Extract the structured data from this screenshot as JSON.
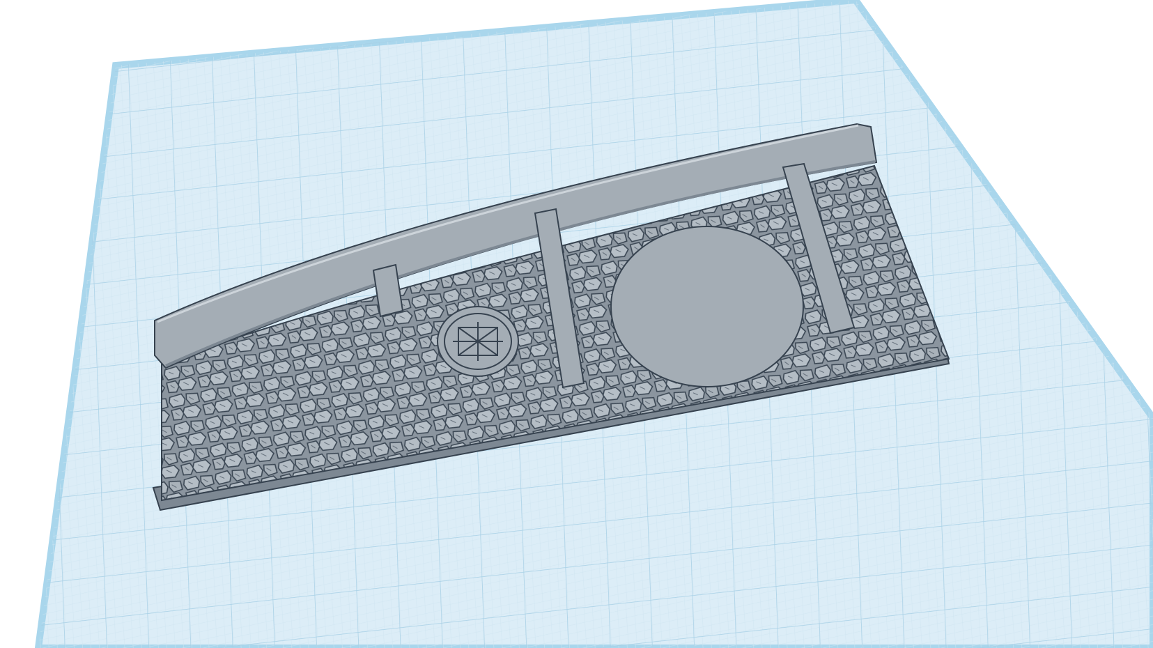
{
  "app": {
    "view": "3d-workplane",
    "description_icon": "workplane-grid-icon"
  },
  "workplane": {
    "grid": true,
    "colors": {
      "background": "#ffffff",
      "plane_fill": "#dcedf7",
      "plane_border": "#a9d6ec",
      "grid_minor": "#cfe5f1",
      "grid_major": "#a6cfe5"
    }
  },
  "model": {
    "name": "stone-wall-tile",
    "features": [
      "curved-top-rail",
      "stone-texture",
      "left-post",
      "middle-post",
      "right-post",
      "round-door-disc",
      "rune-medallion"
    ],
    "colors": {
      "body": "#a4adb5",
      "body_light": "#b9c2ca",
      "body_dark": "#7d8893",
      "outline": "#36424f"
    }
  }
}
